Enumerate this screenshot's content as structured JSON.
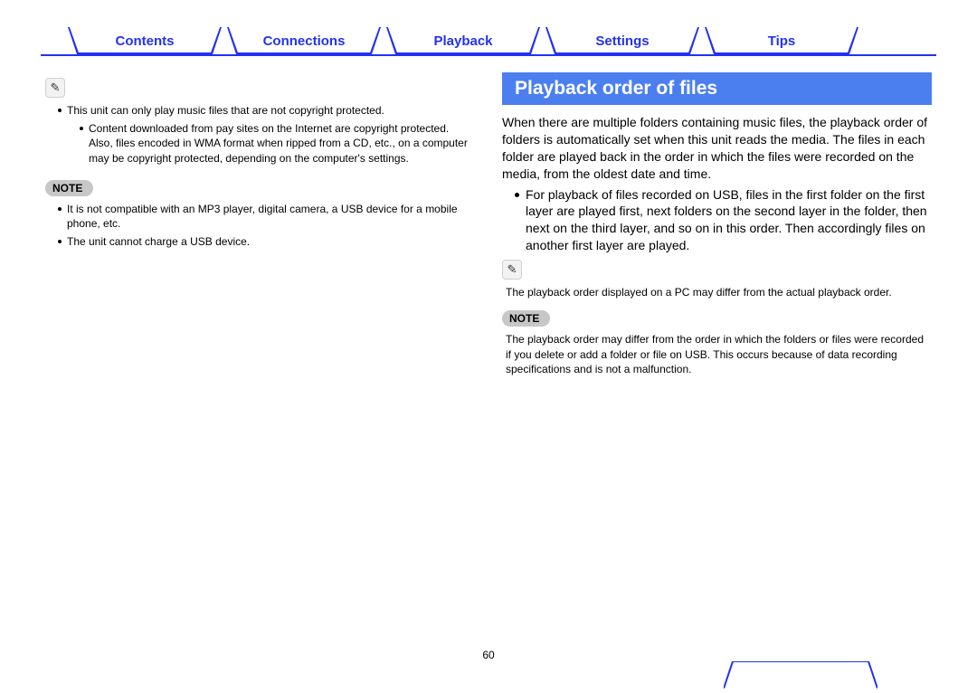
{
  "tabs": {
    "contents": "Contents",
    "connections": "Connections",
    "playback": "Playback",
    "settings": "Settings",
    "tips": "Tips"
  },
  "left": {
    "bullet1": "This unit can only play music files that are not copyright protected.",
    "sub1": "Content downloaded from pay sites on the Internet are copyright protected. Also, files encoded in WMA format when ripped from a CD, etc., on a computer may be copyright protected, depending on the computer's settings.",
    "note_label": "NOTE",
    "note_b1": "It is not compatible with an MP3 player, digital camera, a USB device for a mobile phone, etc.",
    "note_b2": "The unit cannot charge a USB device."
  },
  "right": {
    "heading": "Playback order of files",
    "para1": "When there are multiple folders containing music files, the playback order of folders is automatically set when this unit reads the media. The files in each folder are played back in the order in which the files were recorded on the media, from the oldest date and time.",
    "bullet1": "For playback of files recorded on USB, files in the first folder on the first layer are played first, next folders on the second layer in the folder, then next on the third layer, and so on in this order. Then accordingly files on another first layer are played.",
    "pencil_text": "The playback order displayed on a PC may differ from the actual playback order.",
    "note_label": "NOTE",
    "note_text": "The playback order may differ from the order in which the folders or files were recorded if you delete or add a folder or file on USB. This occurs because of data recording specifications and is not a malfunction."
  },
  "page_number": "60"
}
